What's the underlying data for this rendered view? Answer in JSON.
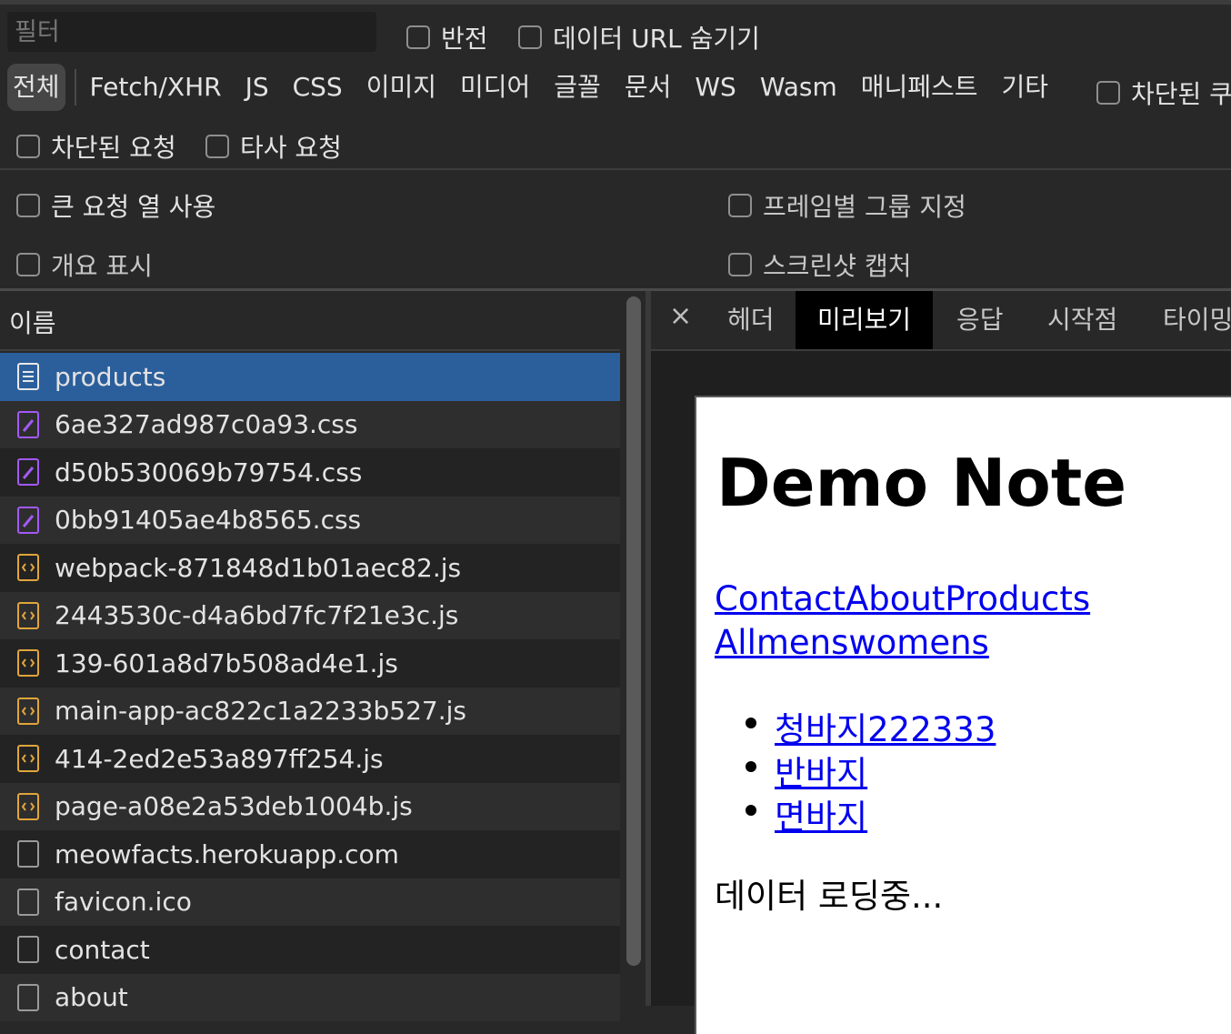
{
  "filter": {
    "placeholder": "필터"
  },
  "filter_options": {
    "invert": "반전",
    "hide_data_url": "데이터 URL 숨기기"
  },
  "type_filters": [
    "전체",
    "Fetch/XHR",
    "JS",
    "CSS",
    "이미지",
    "미디어",
    "글꼴",
    "문서",
    "WS",
    "Wasm",
    "매니페스트",
    "기타"
  ],
  "blocked_cookies": "차단된 쿠",
  "request_filters": {
    "blocked": "차단된 요청",
    "third_party": "타사 요청"
  },
  "settings": {
    "big_rows": "큰 요청 열 사용",
    "group_by_frame": "프레임별 그룹 지정",
    "overview": "개요 표시",
    "screenshot": "스크린샷 캡처"
  },
  "list_header": "이름",
  "requests": [
    {
      "name": "products",
      "type": "document"
    },
    {
      "name": "6ae327ad987c0a93.css",
      "type": "css"
    },
    {
      "name": "d50b530069b79754.css",
      "type": "css"
    },
    {
      "name": "0bb91405ae4b8565.css",
      "type": "css"
    },
    {
      "name": "webpack-871848d1b01aec82.js",
      "type": "js"
    },
    {
      "name": "2443530c-d4a6bd7fc7f21e3c.js",
      "type": "js"
    },
    {
      "name": "139-601a8d7b508ad4e1.js",
      "type": "js"
    },
    {
      "name": "main-app-ac822c1a2233b527.js",
      "type": "js"
    },
    {
      "name": "414-2ed2e53a897ff254.js",
      "type": "js"
    },
    {
      "name": "page-a08e2a53deb1004b.js",
      "type": "js"
    },
    {
      "name": "meowfacts.herokuapp.com",
      "type": "other"
    },
    {
      "name": "favicon.ico",
      "type": "other"
    },
    {
      "name": "contact",
      "type": "other"
    },
    {
      "name": "about",
      "type": "other"
    }
  ],
  "detail_tabs": {
    "close": "×",
    "headers": "헤더",
    "preview": "미리보기",
    "response": "응답",
    "initiator": "시작점",
    "timing": "타이밍"
  },
  "preview": {
    "title": "Demo Note",
    "nav_line1": "ContactAboutProducts",
    "nav_line2": "Allmenswomens",
    "items": [
      "청바지222333",
      "반바지",
      "면바지"
    ],
    "loading": "데이터 로딩중..."
  },
  "colors": {
    "selected_row": "#2b5f9c",
    "css_icon": "#a259f5",
    "js_icon": "#e0a53b",
    "link": "#0000ee"
  }
}
